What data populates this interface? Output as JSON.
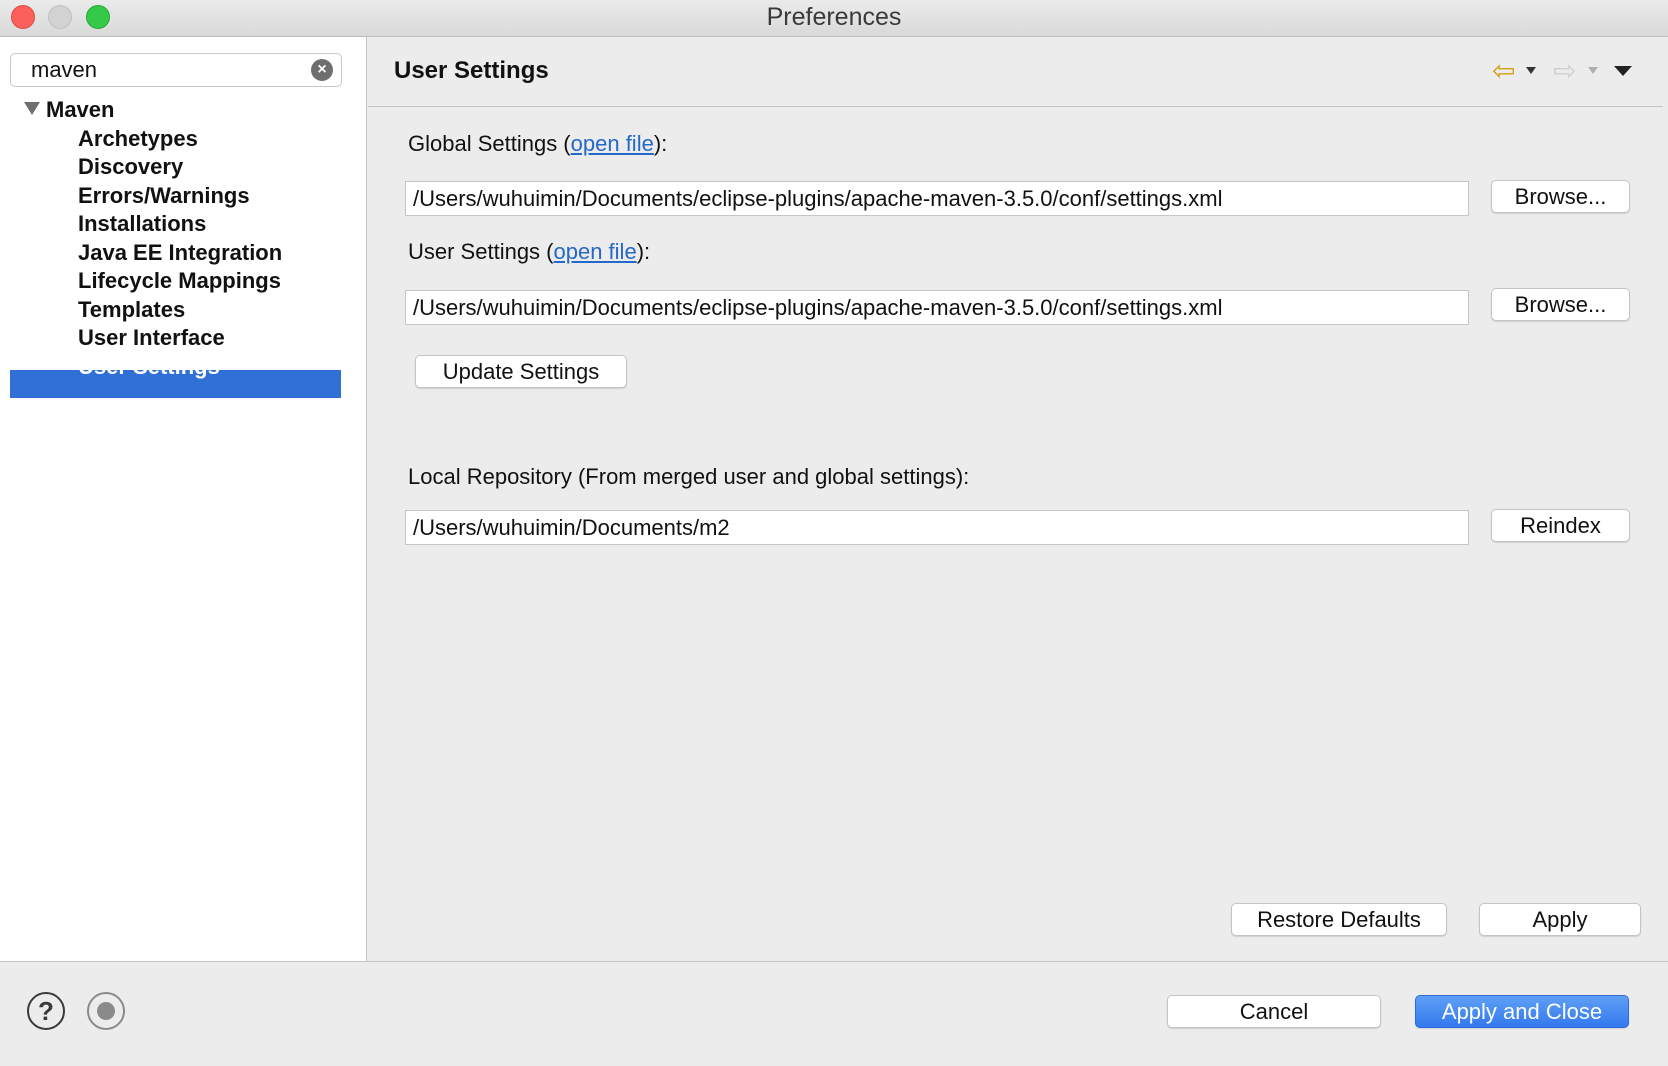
{
  "window": {
    "title": "Preferences"
  },
  "sidebar": {
    "search": {
      "value": "maven"
    },
    "tree": {
      "root": "Maven",
      "items": [
        "Archetypes",
        "Discovery",
        "Errors/Warnings",
        "Installations",
        "Java EE Integration",
        "Lifecycle Mappings",
        "Templates",
        "User Interface",
        "User Settings"
      ],
      "selected": "User Settings"
    }
  },
  "page": {
    "title": "User Settings",
    "global_settings": {
      "label_prefix": "Global Settings (",
      "link": "open file",
      "label_suffix": "):",
      "path": "/Users/wuhuimin/Documents/eclipse-plugins/apache-maven-3.5.0/conf/settings.xml",
      "browse_label": "Browse..."
    },
    "user_settings": {
      "label_prefix": "User Settings (",
      "link": "open file",
      "label_suffix": "):",
      "path": "/Users/wuhuimin/Documents/eclipse-plugins/apache-maven-3.5.0/conf/settings.xml",
      "browse_label": "Browse..."
    },
    "update_settings_label": "Update Settings",
    "local_repository": {
      "label": "Local Repository (From merged user and global settings):",
      "path": "/Users/wuhuimin/Documents/m2",
      "reindex_label": "Reindex"
    },
    "restore_defaults_label": "Restore Defaults",
    "apply_label": "Apply"
  },
  "footer": {
    "help_glyph": "?",
    "cancel_label": "Cancel",
    "apply_and_close_label": "Apply and Close"
  },
  "colors": {
    "selection": "#2f6fd6",
    "link": "#2468c9",
    "primary_button": "#3379ee"
  }
}
